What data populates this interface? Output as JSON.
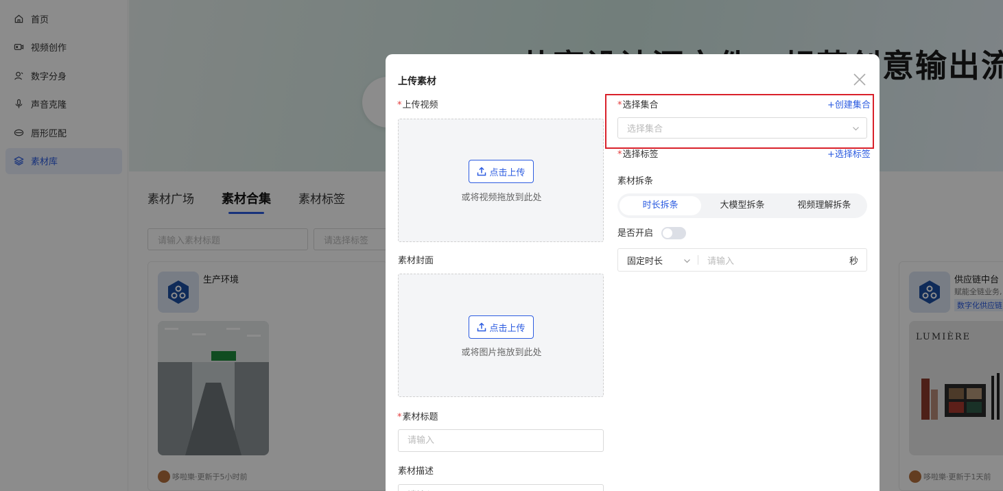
{
  "sidebar": {
    "items": [
      {
        "label": "首页",
        "icon": "home-icon"
      },
      {
        "label": "视频创作",
        "icon": "video-icon"
      },
      {
        "label": "数字分身",
        "icon": "user-icon"
      },
      {
        "label": "声音克隆",
        "icon": "mic-icon"
      },
      {
        "label": "唇形匹配",
        "icon": "mouth-icon"
      },
      {
        "label": "素材库",
        "icon": "layers-icon",
        "active": true
      }
    ]
  },
  "banner": {
    "title": "共享设计源文件，规范创意输出流程"
  },
  "tabs": [
    {
      "label": "素材广场"
    },
    {
      "label": "素材合集",
      "active": true
    },
    {
      "label": "素材标签"
    }
  ],
  "filters": {
    "title_placeholder": "请输入素材标题",
    "tag_placeholder": "请选择标签"
  },
  "cards": [
    {
      "title": "生产环境",
      "author": "哆啦樂·更新于5小时前"
    },
    {
      "title": "供应链中台",
      "desc": "赋能全链业务,",
      "tag": "数字化供应链",
      "brand": "LUMIÈRE",
      "author": "哆啦樂·更新于1天前"
    }
  ],
  "modal": {
    "title": "上传素材",
    "upload_video": {
      "label": "上传视频",
      "button": "点击上传",
      "hint": "或将视频拖放到此处"
    },
    "cover": {
      "label": "素材封面",
      "button": "点击上传",
      "hint": "或将图片拖放到此处"
    },
    "title_field": {
      "label": "素材标题",
      "placeholder": "请输入"
    },
    "desc_field": {
      "label": "素材描述",
      "placeholder": "请输入"
    },
    "collection": {
      "label": "选择集合",
      "link": "+创建集合",
      "placeholder": "选择集合"
    },
    "tags": {
      "label": "选择标签",
      "link": "+选择标签"
    },
    "split": {
      "label": "素材拆条",
      "options": [
        "时长拆条",
        "大模型拆条",
        "视频理解拆条"
      ],
      "active_index": 0
    },
    "enable": {
      "label": "是否开启",
      "on": false
    },
    "duration": {
      "mode": "固定时长",
      "placeholder": "请输入",
      "unit": "秒"
    }
  },
  "colors": {
    "accent": "#2b5be0",
    "required": "#e23b3b",
    "highlight": "#d9202a"
  }
}
